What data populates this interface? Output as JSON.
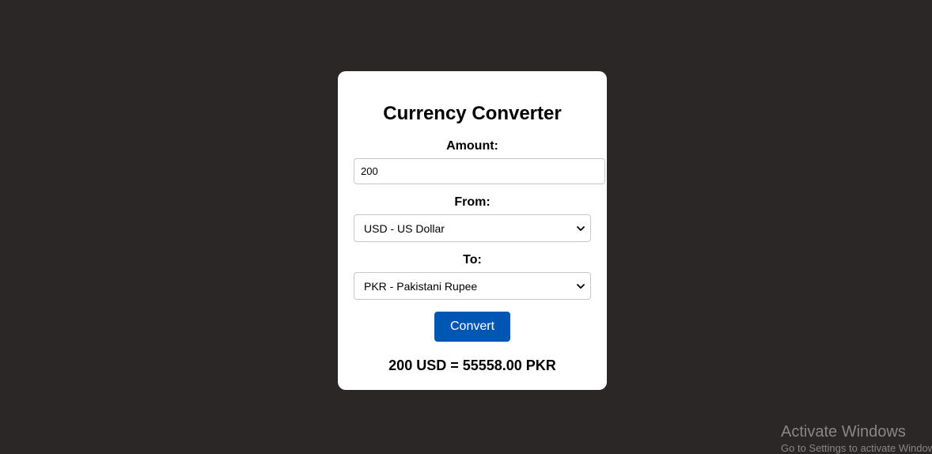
{
  "converter": {
    "title": "Currency Converter",
    "amount_label": "Amount:",
    "amount_value": "200",
    "from_label": "From:",
    "from_selected": "USD - US Dollar",
    "to_label": "To:",
    "to_selected": "PKR - Pakistani Rupee",
    "convert_label": "Convert",
    "result_text": "200 USD = 55558.00 PKR",
    "button_color": "#0056b3",
    "background_color": "#2b2726"
  },
  "watermark": {
    "title": "Activate Windows",
    "subtitle": "Go to Settings to activate Windows."
  }
}
